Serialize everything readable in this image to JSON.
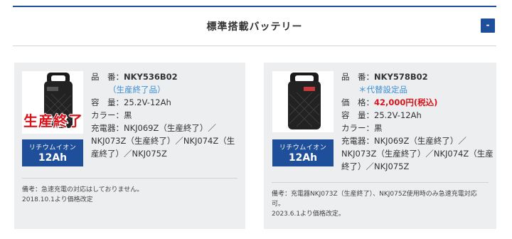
{
  "section": {
    "title": "標準搭載バッテリー",
    "collapse_label": "-"
  },
  "products": [
    {
      "labels": {
        "model": "品　番：",
        "capacity": "容　量：",
        "color": "カラー：",
        "charger": "充電器："
      },
      "model": "NKY536B02",
      "model_note": "（生産終了品）",
      "ended_overlay": "生産終了",
      "capacity": "25.2V-12Ah",
      "color": "黒",
      "charger": "NKJ069Z（生産終了）／NKJ073Z（生産終了）／NKJ074Z（生産終了）／NKJ075Z",
      "badge_type": "リチウムイオン",
      "badge_capacity": "12Ah",
      "note_lines": [
        "備考：急速充電の対応はしておりません。",
        "2018.10.1より価格改定"
      ]
    },
    {
      "labels": {
        "model": "品　番：",
        "price": "価　格：",
        "capacity": "容　量：",
        "color": "カラー：",
        "charger": "充電器："
      },
      "model": "NKY578B02",
      "model_note": "＊代替設定品",
      "price": "42,000円(税込)",
      "capacity": "25.2V-12Ah",
      "color": "黒",
      "charger": "NKJ069Z（生産終了）／NKJ073Z（生産終了）／NKJ074Z（生産終了）／NKJ075Z",
      "badge_type": "リチウムイオン",
      "badge_capacity": "12Ah",
      "note_lines": [
        "備考：充電器NKJ073Z（生産終了）、NKJ075Z使用時のみ急速充電対応可。",
        "2023.6.1より価格改定。"
      ]
    }
  ],
  "colors": {
    "accent": "#1f4f9a",
    "price": "#d8151c",
    "note_blue": "#3d8fd6",
    "card_bg": "#eceef0"
  },
  "icons": [
    "battery-image-icon"
  ]
}
